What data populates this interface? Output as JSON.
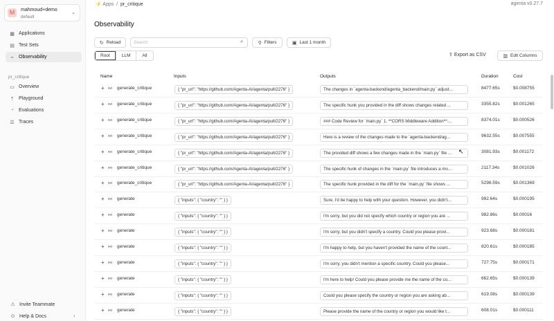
{
  "sidebar": {
    "user_initial": "M",
    "user_name": "mahmoud+demo",
    "org": "default",
    "items": [
      {
        "label": "Applications",
        "icon": "grid-icon"
      },
      {
        "label": "Test Sets",
        "icon": "table-icon"
      },
      {
        "label": "Observability",
        "icon": "chart-icon"
      }
    ],
    "section": "pr_critique",
    "app_items": [
      {
        "label": "Overview",
        "icon": "monitor-icon"
      },
      {
        "label": "Playground",
        "icon": "rocket-icon"
      },
      {
        "label": "Evaluations",
        "icon": "gauge-icon"
      },
      {
        "label": "Traces",
        "icon": "list-icon"
      }
    ],
    "invite": "Invite Teammate",
    "help": "Help & Docs"
  },
  "header": {
    "crumb_root": "Apps",
    "crumb_sep": "/",
    "crumb_app": "pr_critique",
    "version": "agenta v0.27.7",
    "title": "Observability"
  },
  "toolbar": {
    "reload": "Reload",
    "search_placeholder": "Search",
    "filters": "Filters",
    "time_range": "Last 1 month",
    "segments": [
      "Root",
      "LLM",
      "All"
    ],
    "export": "Export as CSV",
    "edit_columns": "Edit Columns"
  },
  "table": {
    "columns": [
      "Name",
      "Inputs",
      "Outputs",
      "Duration",
      "Cost"
    ],
    "rows": [
      {
        "name": "generate_critique",
        "input": "{ \"pr_url\": \"https://github.com/Agenta-AI/agenta/pull/2276\" }",
        "output": "The changes in `agenta-backend/agenta_backend/main.py` adjust...",
        "duration": "8477.65s",
        "cost": "$0.008755"
      },
      {
        "name": "generate_critique",
        "input": "{ \"pr_url\": \"https://github.com/Agenta-AI/agenta/pull/2276\" }",
        "output": "The specific hunk you provided in the diff shows changes related ...",
        "duration": "3355.82s",
        "cost": "$0.001265"
      },
      {
        "name": "generate_critique",
        "input": "{ \"pr_url\": \"https://github.com/Agenta-AI/agenta/pull/2276\" }",
        "output": "### Code Review for `main.py` 1. **CORS Middleware Addition**:...",
        "duration": "8374.01s",
        "cost": "$0.000526"
      },
      {
        "name": "generate_critique",
        "input": "{ \"pr_url\": \"https://github.com/Agenta-AI/agenta/pull/2276\" }",
        "output": "Here is a review of the changes made to the `agenta-backend/ag...",
        "duration": "9632.55s",
        "cost": "$0.007555"
      },
      {
        "name": "generate_critique",
        "input": "{ \"pr_url\": \"https://github.com/Agenta-AI/agenta/pull/2276\" }",
        "output": "The provided diff shows a few changes made in the `main.py` file ...",
        "duration": "3081.93s",
        "cost": "$0.001172"
      },
      {
        "name": "generate_critique",
        "input": "{ \"pr_url\": \"https://github.com/Agenta-AI/agenta/pull/2276\" }",
        "output": "The specific hunk of changes in the `main.py` file introduces a mo...",
        "duration": "2117.34s",
        "cost": "$0.001026"
      },
      {
        "name": "generate_critique",
        "input": "{ \"pr_url\": \"https://github.com/Agenta-AI/agenta/pull/2276\" }",
        "output": "The specific hunk provided in the diff for the `main.py` file shows ...",
        "duration": "5296.59s",
        "cost": "$0.001369"
      },
      {
        "name": "generate",
        "input": "{ \"inputs\": { \"country\": \"\" } }",
        "output": "Sure, I'd be happy to help with your question. However, you didn't...",
        "duration": "992.64s",
        "cost": "$0.000195"
      },
      {
        "name": "generate",
        "input": "{ \"inputs\": { \"country\": \"\" } }",
        "output": "I'm sorry, but you did not specify which country or region you are ...",
        "duration": "982.86s",
        "cost": "$0.00016"
      },
      {
        "name": "generate",
        "input": "{ \"inputs\": { \"country\": \"\" } }",
        "output": "I'm sorry, but you didn't specify a country. Could you please provi...",
        "duration": "923.68s",
        "cost": "$0.000181"
      },
      {
        "name": "generate",
        "input": "{ \"inputs\": { \"country\": \"\" } }",
        "output": "I'm happy to help, but you haven't provided the name of the count...",
        "duration": "820.61s",
        "cost": "$0.000185"
      },
      {
        "name": "generate",
        "input": "{ \"inputs\": { \"country\": \"\" } }",
        "output": "I'm sorry, you didn't mention a specific country. Could you please...",
        "duration": "727.75s",
        "cost": "$0.000171"
      },
      {
        "name": "generate",
        "input": "{ \"inputs\": { \"country\": \"\" } }",
        "output": "I'm here to help! Could you please provide me the name of the co...",
        "duration": "662.65s",
        "cost": "$0.000139"
      },
      {
        "name": "generate",
        "input": "{ \"inputs\": { \"country\": \"\" } }",
        "output": "Could you please specify the country or region you are asking ab...",
        "duration": "619.08s",
        "cost": "$0.000139"
      },
      {
        "name": "generate",
        "input": "{ \"inputs\": { \"country\": \"\" } }",
        "output": "Please provide the name of the country or region you would like t...",
        "duration": "608.01s",
        "cost": "$0.000111"
      }
    ]
  }
}
